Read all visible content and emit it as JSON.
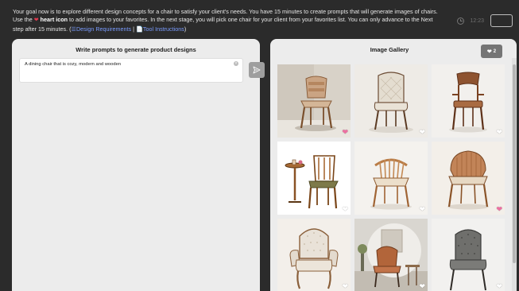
{
  "instructions": {
    "part1": "Your goal now is to explore different design concepts for a chair to satisfy your client's needs. You have 15 minutes to create prompts that will generate images of chairs. Use the ",
    "heart_glyph": "❤",
    "heart_label": "heart icon",
    "part2": " to add images to your favorites. In the next stage, you will pick one chair for your client from your favorites list. You can only advance to the Next step after 15 minutes. (",
    "link_design": "☰Design Requirements",
    "separator": " | ",
    "link_tool": "📄Tool Instructions",
    "close_paren": ")"
  },
  "timer": {
    "value": "12:23"
  },
  "prompt_panel": {
    "title": "Write prompts to generate product designs",
    "prompt_value": "A dining chair that is cozy, modern and wooden",
    "clear_glyph": "×"
  },
  "gallery": {
    "title": "Image Gallery",
    "favorite_count": "2",
    "heart_glyph": "❤",
    "images": [
      {
        "name": "gallery-image-1",
        "favorited": true
      },
      {
        "name": "gallery-image-2",
        "favorited": false
      },
      {
        "name": "gallery-image-3",
        "favorited": false
      },
      {
        "name": "gallery-image-4",
        "favorited": false
      },
      {
        "name": "gallery-image-5",
        "favorited": false
      },
      {
        "name": "gallery-image-6",
        "favorited": true
      },
      {
        "name": "gallery-image-7",
        "favorited": false
      },
      {
        "name": "gallery-image-8",
        "favorited": false
      },
      {
        "name": "gallery-image-9",
        "favorited": false
      }
    ]
  },
  "colors": {
    "background": "#2b2b2b",
    "panel": "#ececec",
    "accent_link": "#7a9cff",
    "heart_red": "#e53950",
    "heart_pink": "#ee6fa1"
  },
  "icons": [
    "heart-icon",
    "clock-icon",
    "send-icon",
    "clear-icon",
    "list-icon",
    "document-icon"
  ]
}
